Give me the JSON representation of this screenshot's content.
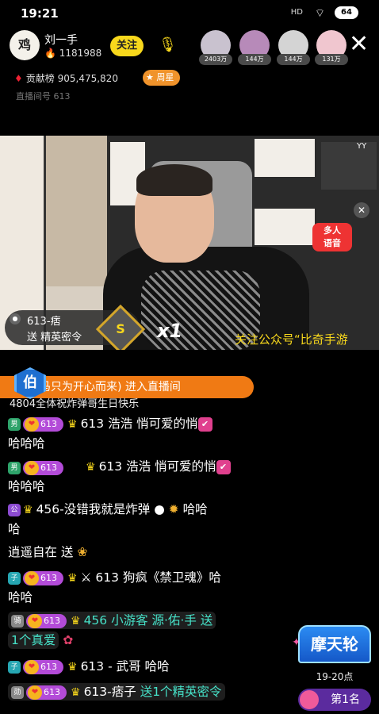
{
  "status_bar": {
    "time": "19:21",
    "signal": "HD",
    "battery": "64"
  },
  "streamer": {
    "avatar_text": "鸡",
    "name": "刘一手",
    "fans": "1181988",
    "follow_label": "关注"
  },
  "viewers": [
    {
      "count": "2403万",
      "color": "#c9c2cf"
    },
    {
      "count": "144万",
      "color": "#b78ab9"
    },
    {
      "count": "144万",
      "color": "#d4d4d4"
    },
    {
      "count": "131万",
      "color": "#f0c6cf"
    }
  ],
  "contribution": {
    "label": "贡献榜",
    "value": "905,475,820",
    "star_label": "周星"
  },
  "room": {
    "label": "直播间号",
    "id": "613"
  },
  "video": {
    "yy": "YY",
    "badge": "多人\n语音",
    "gift": {
      "sender": "613-痞",
      "text": "送 精英密令",
      "badge": "S",
      "combo": "x1"
    },
    "banner": "关注公众号“比奇手游"
  },
  "entry": {
    "badge": "伯",
    "text": "马只为开心而来) 进入直播间"
  },
  "ticker": "4804全体祝炸弹哥生日快乐",
  "messages": [
    {
      "level": "男",
      "fan": "613",
      "user": "613 浩浩",
      "text": "悄可爱的悄",
      "line2": "哈哈哈"
    },
    {
      "level": "男",
      "fan": "613",
      "user": "613 浩浩",
      "text": "悄可爱的悄",
      "line2": "哈哈哈"
    },
    {
      "level": "公",
      "user": "456-没错我就是炸弹",
      "text": "哈哈",
      "line2": "哈"
    },
    {
      "plain": "逍遥自在 送"
    },
    {
      "level": "子",
      "fan": "613",
      "user": "613  狗疯《禁卫魂》",
      "text": "哈",
      "line2": "哈哈"
    },
    {
      "level": "骑",
      "fan": "613",
      "user": "456 小游客 源·佑·手",
      "text": "送",
      "line2": "1个真爱"
    },
    {
      "level": "子",
      "fan": "613",
      "user": "613 - 武哥",
      "text": "哈哈"
    },
    {
      "level": "勋",
      "fan": "613",
      "user": "613-痞子",
      "text": "送1个精英密令"
    }
  ],
  "wheel": {
    "title": "摩天轮",
    "time": "19-20点",
    "rank": "第1名"
  }
}
